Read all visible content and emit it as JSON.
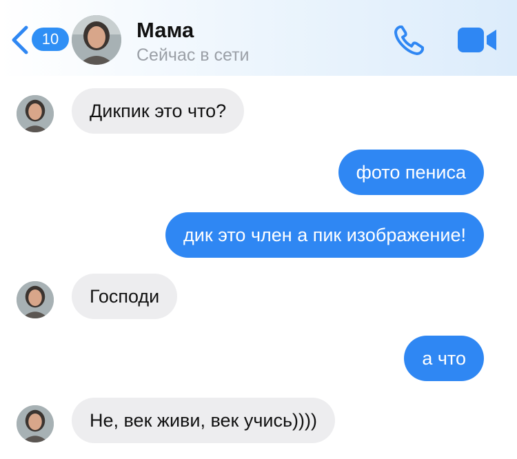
{
  "header": {
    "back_count": "10",
    "contact_name": "Мама",
    "contact_status": "Сейчас в сети",
    "icons": [
      "chevron-left-icon",
      "phone-icon",
      "video-camera-icon"
    ],
    "accent_color": "#2f87f3"
  },
  "messages": [
    {
      "direction": "incoming",
      "text": "Дикпик это что?"
    },
    {
      "direction": "outgoing",
      "text": "фото пениса"
    },
    {
      "direction": "outgoing",
      "text": "дик это член а пик изображение!"
    },
    {
      "direction": "incoming",
      "text": "Господи"
    },
    {
      "direction": "outgoing",
      "text": "а что"
    },
    {
      "direction": "incoming",
      "text": "Не, век живи, век учись))))"
    }
  ]
}
